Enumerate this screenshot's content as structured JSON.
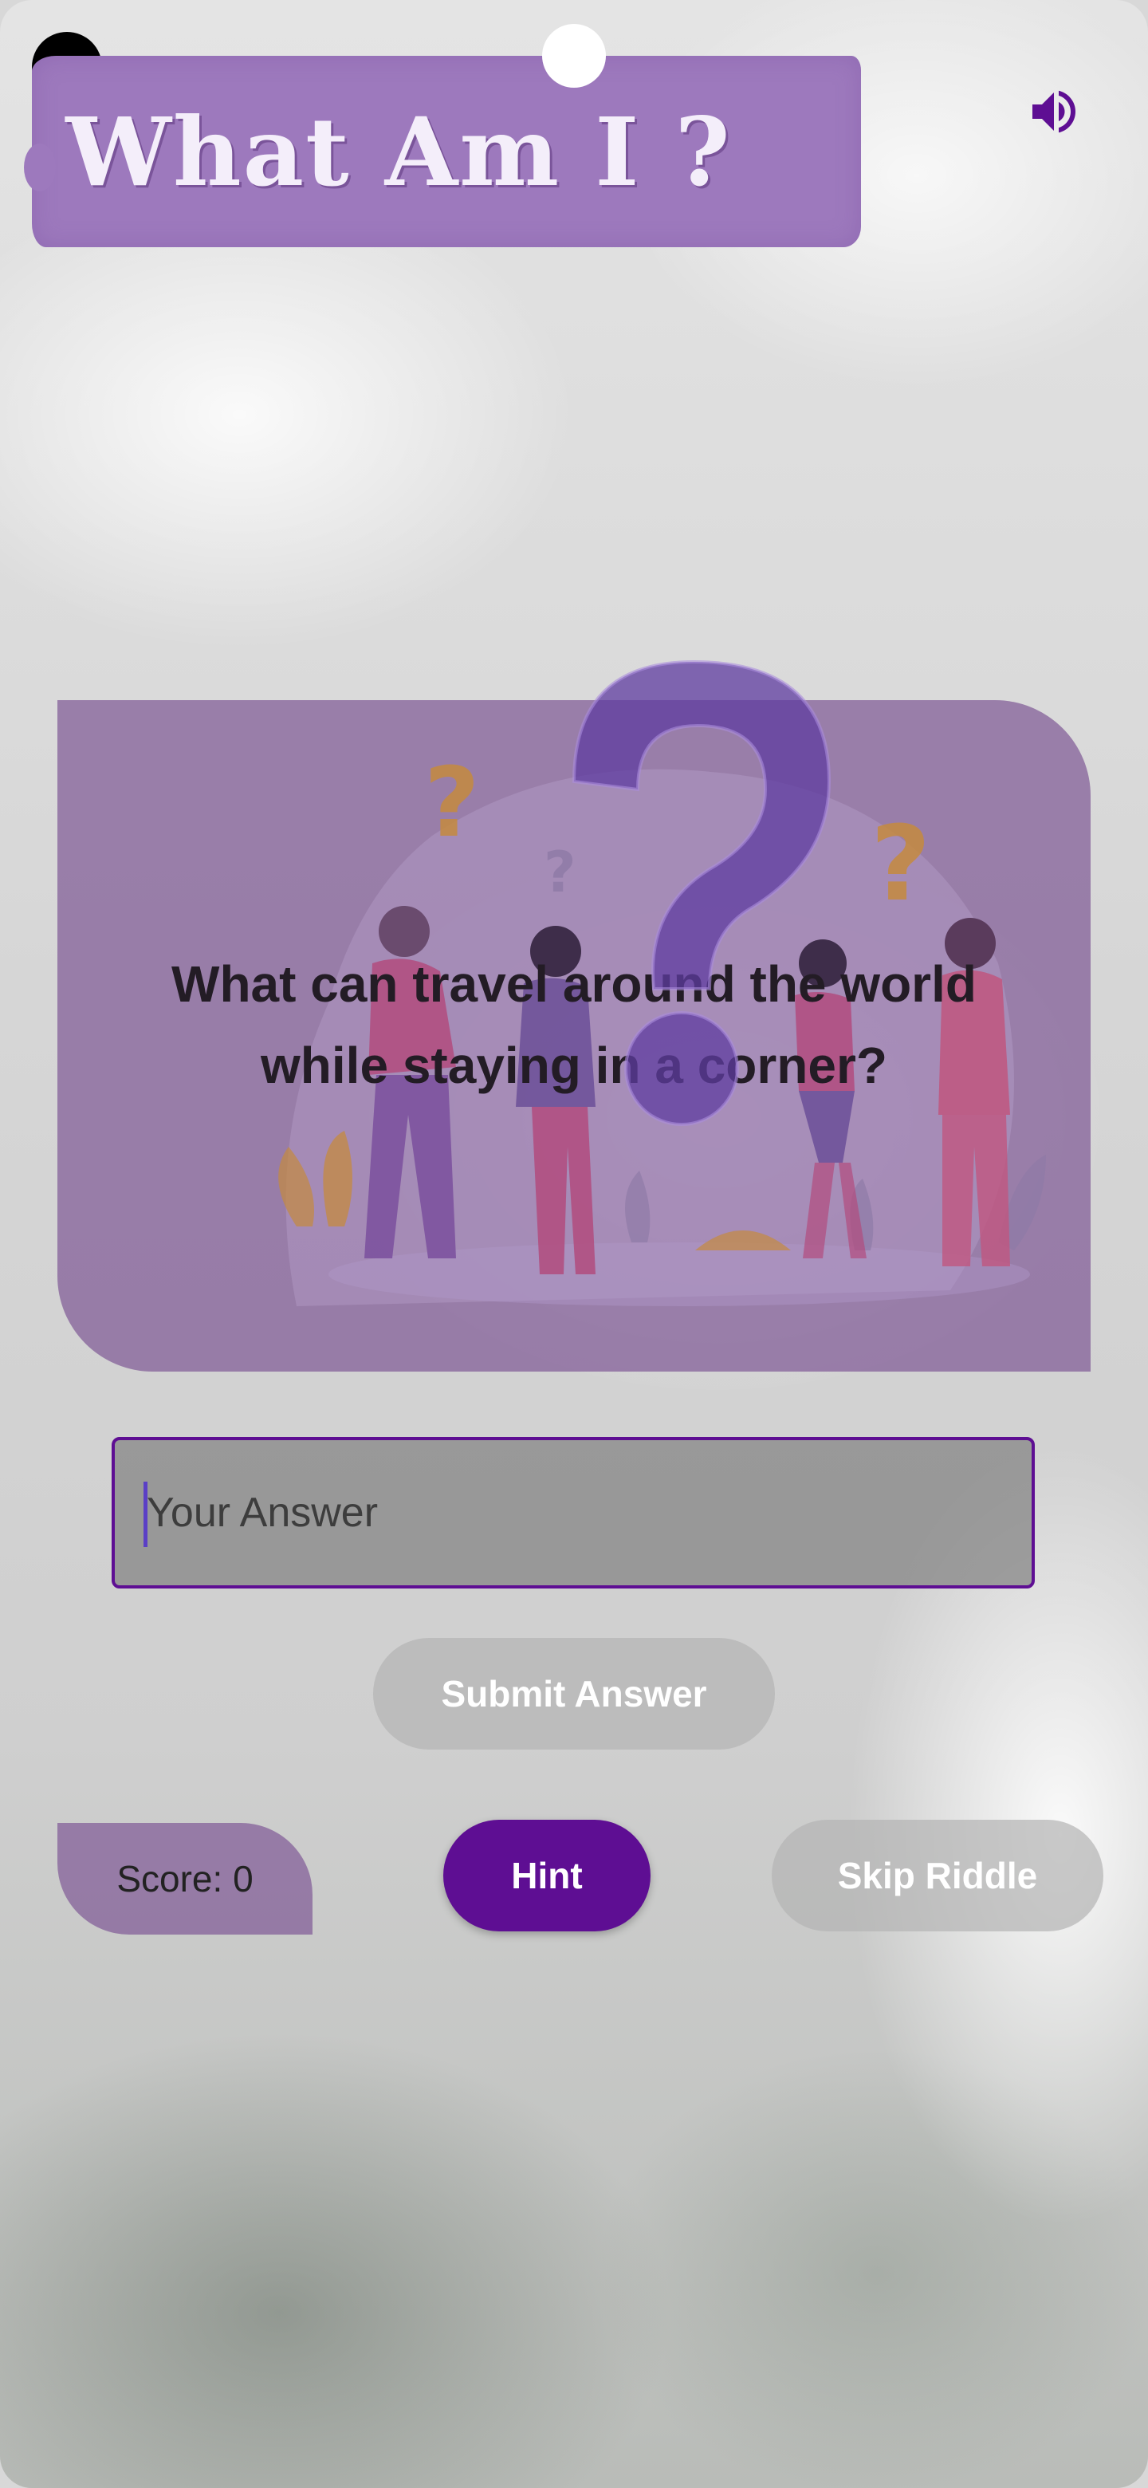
{
  "header": {
    "title": "What Am I ?",
    "sound_icon": "speaker-volume-icon"
  },
  "riddle": {
    "question": "What can travel around the world while staying in a corner?",
    "illustration": "people-with-question-marks-illustration"
  },
  "answer": {
    "placeholder": "Your Answer",
    "value": ""
  },
  "actions": {
    "submit_label": "Submit Answer",
    "hint_label": "Hint",
    "skip_label": "Skip Riddle"
  },
  "score": {
    "label": "Score: 0"
  },
  "colors": {
    "accent": "#5e0e93",
    "banner": "#9d79bd",
    "card": "#86649b"
  }
}
